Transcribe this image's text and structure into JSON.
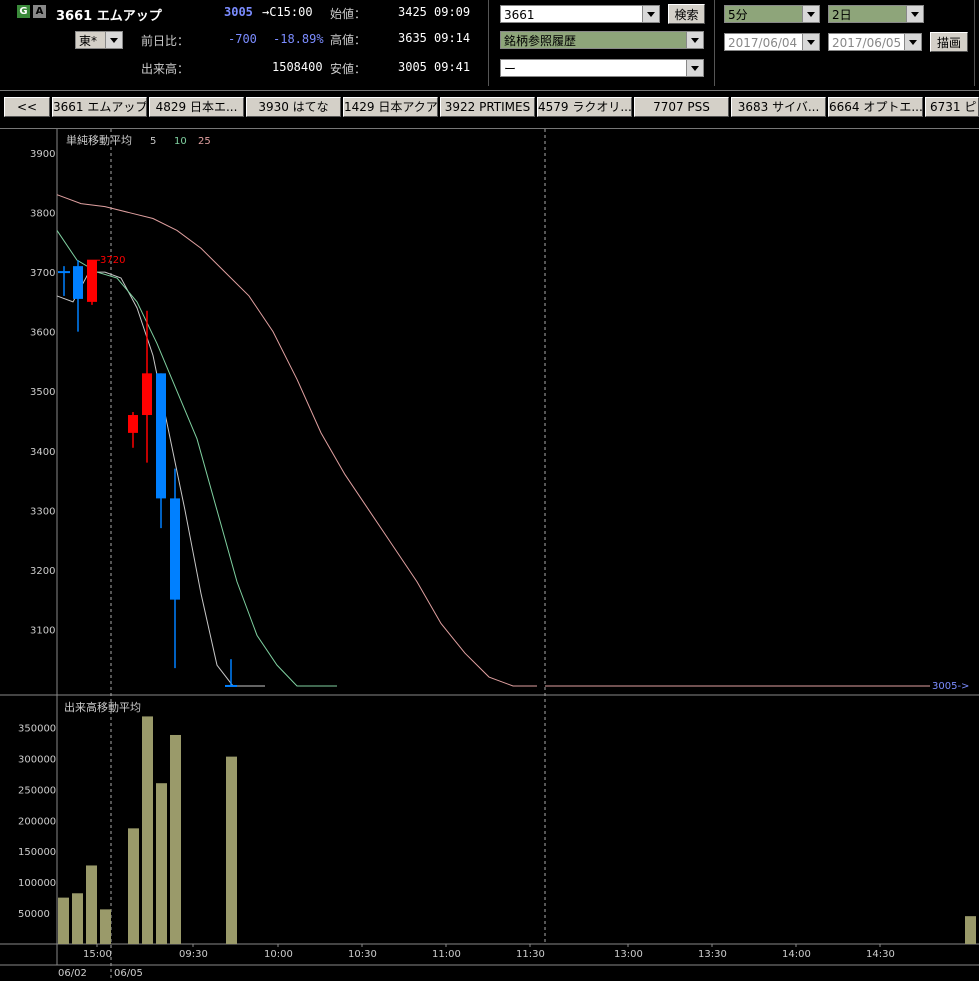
{
  "header": {
    "g_icon": "G",
    "alert_icon": "A",
    "ticker": "3661 エムアップ",
    "last_price": "3005",
    "last_time": "→C15:00",
    "open_label": "始値：",
    "open_value": "3425",
    "open_time": "09:09",
    "high_label": "高値：",
    "high_value": "3635",
    "high_time": "09:14",
    "low_label": "安値：",
    "low_value": "3005",
    "low_time": "09:41",
    "change_label": "前日比：",
    "change_value": "-700",
    "change_pct": "-18.89%",
    "volume_label": "出来高：",
    "volume_value": "1508400",
    "exchange": "東*"
  },
  "controls": {
    "code_input": "3661",
    "search_button": "検索",
    "history_select": "銘柄参照履歴",
    "blank_select": "ー",
    "interval_select": "5分",
    "span_select": "2日",
    "date_from": "2017/06/04",
    "date_to": "2017/06/05",
    "draw_button": "描画"
  },
  "tabs": {
    "back": "<<",
    "items": [
      "3661 エムアップ",
      "4829 日本エ...",
      "3930 はてな",
      "1429 日本アクア",
      "3922 PRTIMES",
      "4579 ラクオリ...",
      "7707 PSS",
      "3683 サイバ...",
      "6664 オプトエ...",
      "6731 ピ"
    ]
  },
  "price_panel": {
    "title": "単純移動平均",
    "ma_labels": [
      "5",
      "10",
      "25"
    ],
    "y_ticks": [
      "3900",
      "3800",
      "3700",
      "3600",
      "3500",
      "3400",
      "3300",
      "3200",
      "3100"
    ],
    "high_marker": "3720",
    "last_marker": "3005->"
  },
  "volume_panel": {
    "title": "出来高移動平均",
    "y_ticks": [
      "350000",
      "300000",
      "250000",
      "200000",
      "150000",
      "100000",
      "50000"
    ]
  },
  "time_axis": {
    "labels": [
      "15:00",
      "09:30",
      "10:00",
      "10:30",
      "11:00",
      "11:30",
      "13:00",
      "13:30",
      "14:00",
      "14:30"
    ],
    "dates": [
      "06/02",
      "06/05"
    ]
  },
  "colors": {
    "up": "#0080ff",
    "down": "#ff0000",
    "volume": "#9a9a6a",
    "ma5": "#c8c8c8",
    "ma10": "#7fd0a0",
    "ma25": "#e0a0a0"
  },
  "chart_data": {
    "type": "candlestick",
    "interval": "5分",
    "candles": [
      {
        "time": "06/02 14:40",
        "open": 3700,
        "high": 3710,
        "low": 3660,
        "close": 3700
      },
      {
        "time": "06/02 14:45",
        "open": 3655,
        "high": 3720,
        "low": 3600,
        "close": 3710
      },
      {
        "time": "06/02 14:55",
        "open": 3720,
        "high": 3720,
        "low": 3645,
        "close": 3650
      },
      {
        "time": "06/05 09:05",
        "open": 3460,
        "high": 3465,
        "low": 3405,
        "close": 3430
      },
      {
        "time": "06/05 09:10",
        "open": 3530,
        "high": 3635,
        "low": 3380,
        "close": 3460
      },
      {
        "time": "06/05 09:15",
        "open": 3320,
        "high": 3530,
        "low": 3270,
        "close": 3530
      },
      {
        "time": "06/05 09:20",
        "open": 3150,
        "high": 3370,
        "low": 3035,
        "close": 3320
      },
      {
        "time": "06/05 09:40",
        "open": 3005,
        "high": 3050,
        "low": 3005,
        "close": 3005
      }
    ],
    "volume": [
      {
        "time": "06/02 14:40",
        "value": 75000
      },
      {
        "time": "06/02 14:45",
        "value": 82000
      },
      {
        "time": "06/02 14:50",
        "value": 127000
      },
      {
        "time": "06/02 15:00",
        "value": 56000
      },
      {
        "time": "06/05 09:05",
        "value": 187000
      },
      {
        "time": "06/05 09:10",
        "value": 368000
      },
      {
        "time": "06/05 09:15",
        "value": 260000
      },
      {
        "time": "06/05 09:20",
        "value": 338000
      },
      {
        "time": "06/05 09:40",
        "value": 303000
      },
      {
        "time": "06/05 15:00",
        "value": 45000
      }
    ],
    "price_ylim": [
      3000,
      3920
    ],
    "volume_ylim": [
      0,
      380000
    ],
    "ma5": [
      [
        3660,
        3650,
        3700,
        3700,
        3690,
        3640,
        3560,
        3430,
        3300,
        3160,
        3040,
        3005,
        3005,
        3005
      ]
    ],
    "ma10": [
      [
        3770,
        3720,
        3700,
        3690,
        3650,
        3580,
        3500,
        3420,
        3300,
        3180,
        3090,
        3040,
        3005,
        3005,
        3005
      ]
    ],
    "ma25": [
      [
        3830,
        3815,
        3810,
        3800,
        3790,
        3770,
        3740,
        3700,
        3660,
        3600,
        3520,
        3430,
        3360,
        3300,
        3240,
        3180,
        3110,
        3060,
        3020,
        3005,
        3005
      ]
    ]
  }
}
